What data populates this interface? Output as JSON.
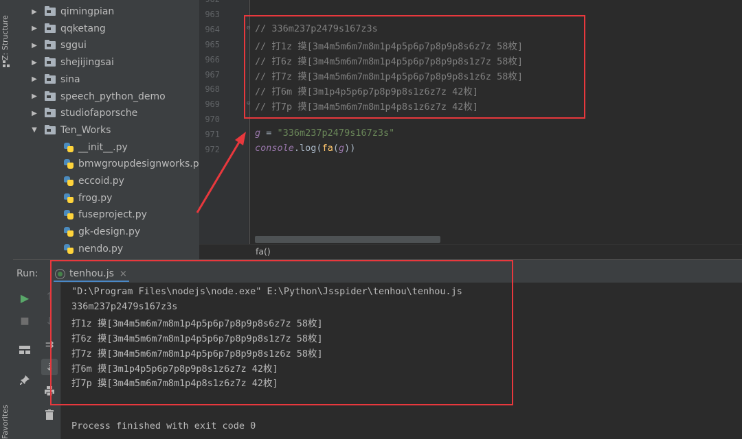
{
  "left_strip": {
    "structure_label": "Z: Structure",
    "favorites_label": "Favorites"
  },
  "tree": {
    "items": [
      {
        "label": "qimingpian",
        "kind": "folder",
        "expanded": false
      },
      {
        "label": "qqketang",
        "kind": "folder",
        "expanded": false
      },
      {
        "label": "sggui",
        "kind": "folder",
        "expanded": false
      },
      {
        "label": "shejijingsai",
        "kind": "folder",
        "expanded": false
      },
      {
        "label": "sina",
        "kind": "folder",
        "expanded": false
      },
      {
        "label": "speech_python_demo",
        "kind": "folder",
        "expanded": false
      },
      {
        "label": "studiofaporsche",
        "kind": "folder",
        "expanded": false
      },
      {
        "label": "Ten_Works",
        "kind": "folder",
        "expanded": true
      },
      {
        "label": "__init__.py",
        "kind": "python-file"
      },
      {
        "label": "bmwgroupdesignworks.py",
        "kind": "python-file"
      },
      {
        "label": "eccoid.py",
        "kind": "python-file"
      },
      {
        "label": "frog.py",
        "kind": "python-file"
      },
      {
        "label": "fuseproject.py",
        "kind": "python-file"
      },
      {
        "label": "gk-design.py",
        "kind": "python-file"
      },
      {
        "label": "nendo.py",
        "kind": "python-file"
      }
    ]
  },
  "editor": {
    "line_numbers": [
      "962",
      "963",
      "964",
      "965",
      "966",
      "967",
      "968",
      "969",
      "970",
      "971",
      "972"
    ],
    "comment_lines": [
      "// 336m237p2479s167z3s",
      "// 打1z 摸[3m4m5m6m7m8m1p4p5p6p7p8p9p8s6z7z 58枚]",
      "// 打6z 摸[3m4m5m6m7m8m1p4p5p6p7p8p9p8s1z7z 58枚]",
      "// 打7z 摸[3m4m5m6m7m8m1p4p5p6p7p8p9p8s1z6z 58枚]",
      "// 打6m 摸[3m1p4p5p6p7p8p9p8s1z6z7z 42枚]",
      "// 打7p 摸[3m4m5m6m7m8m1p4p8s1z6z7z 42枚]"
    ],
    "assign": {
      "var": "g",
      "op": " = ",
      "value": "\"336m237p2479s167z3s\""
    },
    "call": {
      "obj": "console",
      "dot": ".",
      "method": "log",
      "open": "(",
      "fn": "fa",
      "open2": "(",
      "arg": "g",
      "close": "))"
    },
    "breadcrumb": "fa()"
  },
  "run_panel": {
    "label": "Run:",
    "tab_label": "tenhou.js",
    "tab_close": "×",
    "console_lines": [
      "\"D:\\Program Files\\nodejs\\node.exe\" E:\\Python\\Jsspider\\tenhou\\tenhou.js",
      "336m237p2479s167z3s",
      "打1z 摸[3m4m5m6m7m8m1p4p5p6p7p8p9p8s6z7z 58枚]",
      "打6z 摸[3m4m5m6m7m8m1p4p5p6p7p8p9p8s1z7z 58枚]",
      "打7z 摸[3m4m5m6m7m8m1p4p5p6p7p8p9p8s1z6z 58枚]",
      "打6m 摸[3m1p4p5p6p7p8p9p8s1z6z7z 42枚]",
      "打7p 摸[3m4m5m6m7m8m1p4p8s1z6z7z 42枚]"
    ],
    "exit_message": "Process finished with exit code 0"
  },
  "colors": {
    "annotation_red": "#e8383d",
    "comment": "#808080",
    "string": "#6a8759",
    "variable": "#9876aa",
    "function": "#ffc66d"
  }
}
